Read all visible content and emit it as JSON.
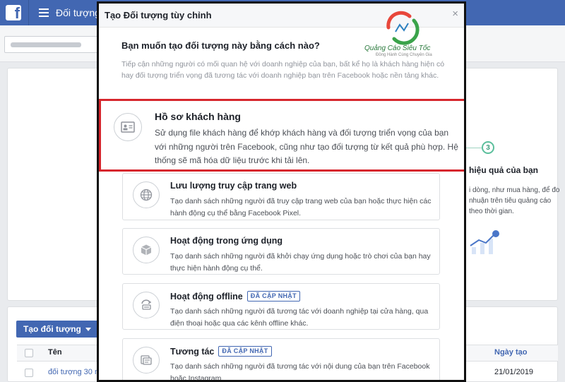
{
  "topbar": {
    "title": "Đối tượng"
  },
  "background": {
    "step_number": "3",
    "right_title": "hiệu quả của bạn",
    "right_desc": "i dòng, như mua hàng, để đo nhuận trên tiêu quảng cáo theo thời gian.",
    "create_button": "Tạo đối tượng",
    "table": {
      "col_name": "Tên",
      "col_date": "Ngày tạo",
      "row_name": "đối tượng 30 n",
      "row_date": "21/01/2019"
    }
  },
  "modal": {
    "title": "Tạo Đối tượng tùy chỉnh",
    "close": "×",
    "question": "Bạn muốn tạo đối tượng này bằng cách nào?",
    "intro": "Tiếp cận những người có mối quan hệ với doanh nghiệp của bạn, bất kể họ là khách hàng hiện có hay đối tượng triển vọng đã tương tác với doanh nghiệp bạn trên Facebook hoặc nền tảng khác.",
    "watermark": {
      "brand": "Quảng Cáo Siêu Tốc",
      "tagline": "Đồng Hành Cùng Chuyên Gia"
    },
    "options": [
      {
        "title": "Hồ sơ khách hàng",
        "desc": "Sử dụng file khách hàng để khớp khách hàng và đối tượng triển vọng của bạn với những người trên Facebook, cũng như tạo đối tượng từ kết quả phù hợp. Hệ thống sẽ mã hóa dữ liệu trước khi tải lên.",
        "icon": "contact-card-icon"
      },
      {
        "title": "Lưu lượng truy cập trang web",
        "desc": "Tạo danh sách những người đã truy cập trang web của bạn hoặc thực hiện các hành động cụ thể bằng Facebook Pixel.",
        "icon": "globe-icon"
      },
      {
        "title": "Hoạt động trong ứng dụng",
        "desc": "Tạo danh sách những người đã khởi chạy ứng dụng hoặc trò chơi của bạn hay thực hiện hành động cụ thể.",
        "icon": "box-icon"
      },
      {
        "title": "Hoạt động offline",
        "badge": "ĐÃ CẬP NHẬT",
        "desc": "Tạo danh sách những người đã tương tác với doanh nghiệp tại cửa hàng, qua điện thoại hoặc qua các kênh offline khác.",
        "icon": "offline-icon"
      },
      {
        "title": "Tương tác",
        "badge": "ĐÃ CẬP NHẬT",
        "desc": "Tạo danh sách những người đã tương tác với nội dung của bạn trên Facebook hoặc Instagram.",
        "icon": "engagement-icon"
      }
    ]
  },
  "colors": {
    "brand": "#4267b2",
    "highlight_border": "#d7262d",
    "badge": "#4267b2"
  }
}
